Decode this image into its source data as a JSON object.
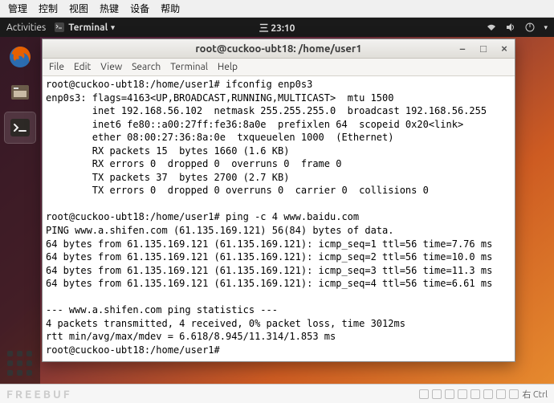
{
  "vm_menu": [
    "管理",
    "控制",
    "视图",
    "热键",
    "设备",
    "帮助"
  ],
  "ubuntu_bar": {
    "activities": "Activities",
    "app_label": "Terminal",
    "clock": "三 23:10"
  },
  "terminal": {
    "title": "root@cuckoo-ubt18: /home/user1",
    "menu": [
      "File",
      "Edit",
      "View",
      "Search",
      "Terminal",
      "Help"
    ],
    "win_min": "–",
    "win_max": "□",
    "win_close": "×",
    "lines": [
      "root@cuckoo-ubt18:/home/user1# ifconfig enp0s3",
      "enp0s3: flags=4163<UP,BROADCAST,RUNNING,MULTICAST>  mtu 1500",
      "        inet 192.168.56.102  netmask 255.255.255.0  broadcast 192.168.56.255",
      "        inet6 fe80::a00:27ff:fe36:8a0e  prefixlen 64  scopeid 0x20<link>",
      "        ether 08:00:27:36:8a:0e  txqueuelen 1000  (Ethernet)",
      "        RX packets 15  bytes 1660 (1.6 KB)",
      "        RX errors 0  dropped 0  overruns 0  frame 0",
      "        TX packets 37  bytes 2700 (2.7 KB)",
      "        TX errors 0  dropped 0 overruns 0  carrier 0  collisions 0",
      "",
      "root@cuckoo-ubt18:/home/user1# ping -c 4 www.baidu.com",
      "PING www.a.shifen.com (61.135.169.121) 56(84) bytes of data.",
      "64 bytes from 61.135.169.121 (61.135.169.121): icmp_seq=1 ttl=56 time=7.76 ms",
      "64 bytes from 61.135.169.121 (61.135.169.121): icmp_seq=2 ttl=56 time=10.0 ms",
      "64 bytes from 61.135.169.121 (61.135.169.121): icmp_seq=3 ttl=56 time=11.3 ms",
      "64 bytes from 61.135.169.121 (61.135.169.121): icmp_seq=4 ttl=56 time=6.61 ms",
      "",
      "--- www.a.shifen.com ping statistics ---",
      "4 packets transmitted, 4 received, 0% packet loss, time 3012ms",
      "rtt min/avg/max/mdev = 6.618/8.945/11.314/1.853 ms",
      "root@cuckoo-ubt18:/home/user1# "
    ]
  },
  "status_bar": {
    "watermark": "FREEBUF",
    "host_key": "右 Ctrl"
  }
}
